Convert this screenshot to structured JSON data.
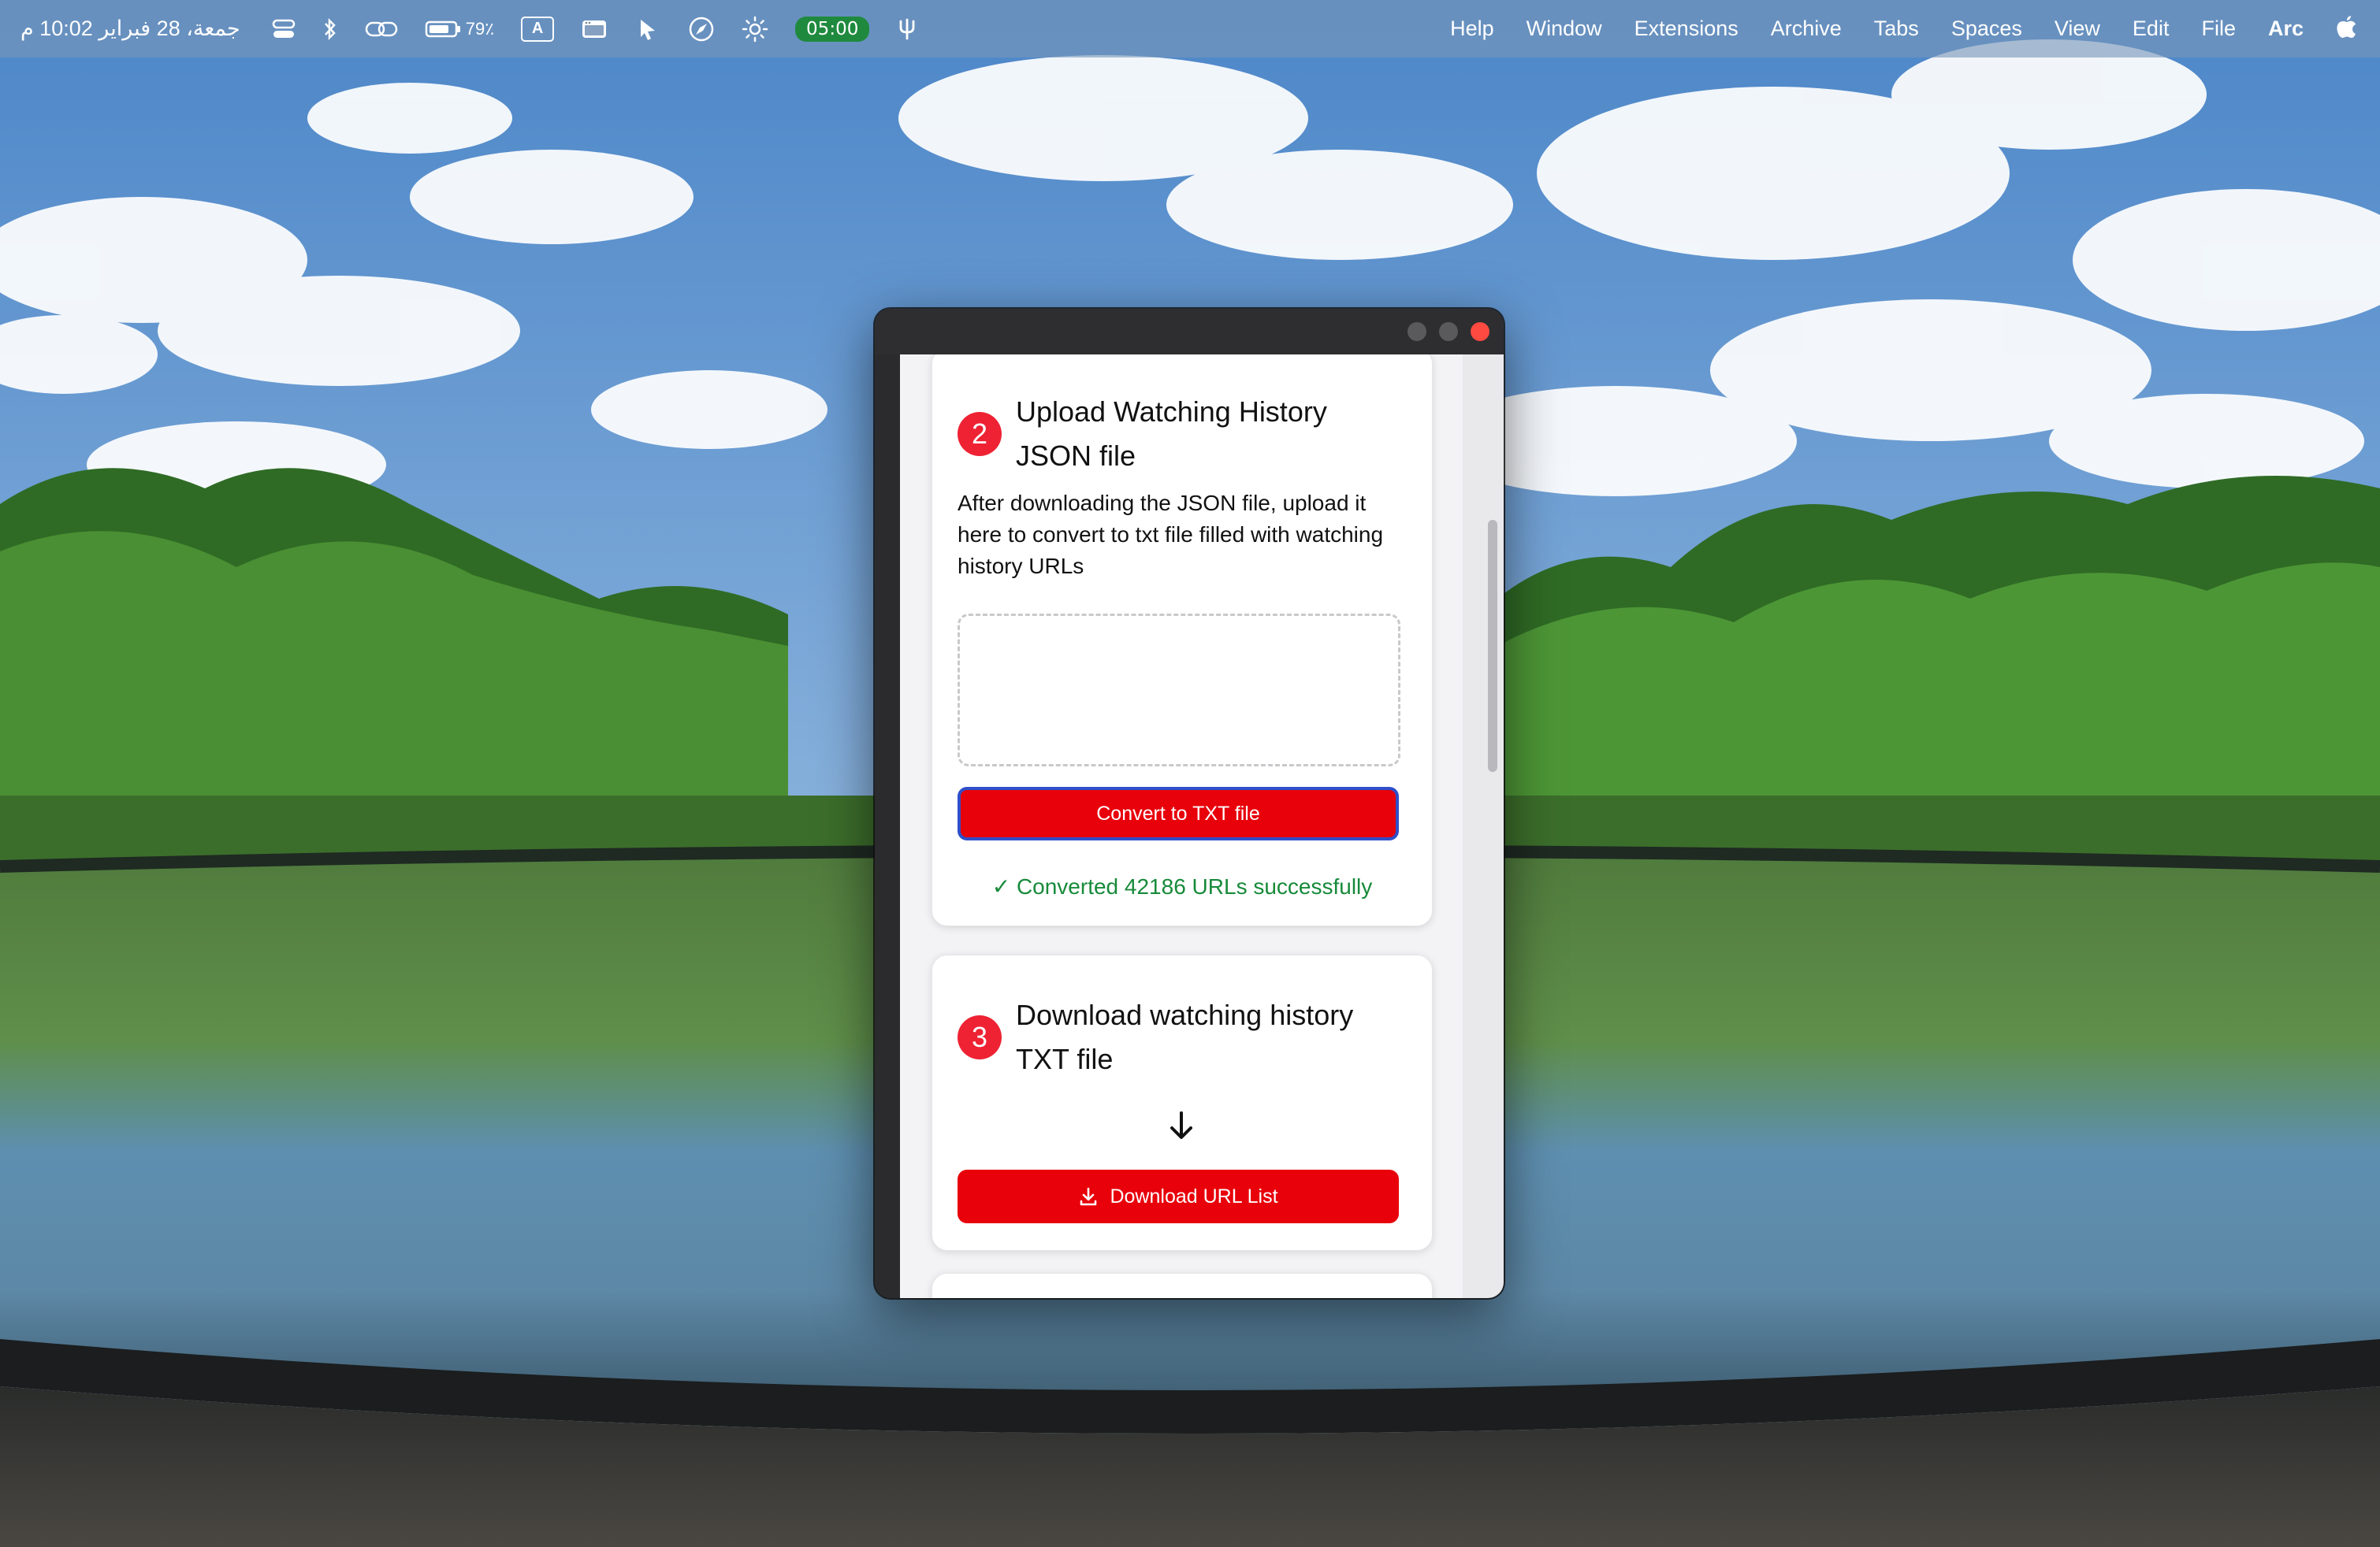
{
  "menubar": {
    "apple_icon": "apple-logo-icon",
    "app_name": "Arc",
    "menus": [
      "File",
      "Edit",
      "View",
      "Spaces",
      "Tabs",
      "Archive",
      "Extensions",
      "Window",
      "Help"
    ],
    "timer": "05:00",
    "battery_percent": "79٪",
    "input_source": "A",
    "clock": "جمعة، 28 فبراير  10:02 م"
  },
  "window": {
    "step2": {
      "number": "2",
      "title": "Upload Watching History JSON file",
      "description": "After downloading the JSON file, upload it here to convert to txt file filled with watching history URLs",
      "button_label": "Convert to TXT file",
      "status": "✓ Converted 42186 URLs successfully"
    },
    "step3": {
      "number": "3",
      "title": "Download watching history TXT file",
      "button_label": "Download URL List"
    }
  },
  "colors": {
    "accent_red": "#e8000a",
    "badge_red": "#ee2233",
    "success_green": "#178a3a",
    "focus_ring": "#2f4ec9"
  }
}
